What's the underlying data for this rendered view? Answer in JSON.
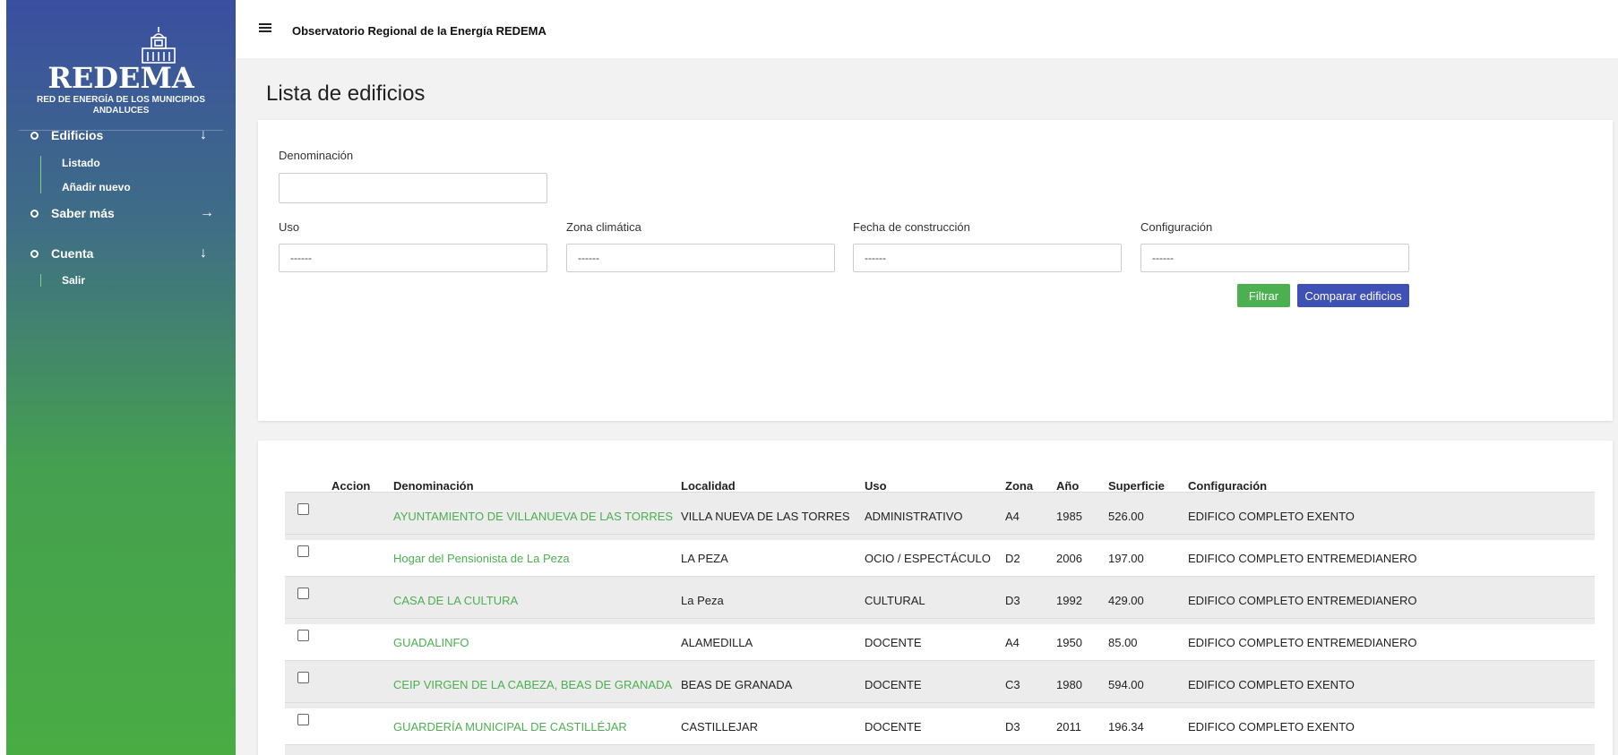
{
  "sidebar": {
    "logo": {
      "title": "REDEMA",
      "subtitle_line1": "RED DE ENERGÍA DE LOS MUNICIPIOS",
      "subtitle_line2": "ANDALUCES"
    },
    "nav": [
      {
        "label": "Edificios",
        "arrow": "↓",
        "children": [
          {
            "label": "Listado"
          },
          {
            "label": "Añadir nuevo"
          }
        ]
      },
      {
        "label": "Saber más",
        "arrow": "→",
        "children": []
      },
      {
        "label": "Cuenta",
        "arrow": "↓",
        "children": [
          {
            "label": "Salir"
          }
        ]
      }
    ]
  },
  "topbar": {
    "title": "Observatorio Regional de la Energía REDEMA"
  },
  "page": {
    "title": "Lista de edificios"
  },
  "filters": {
    "denominacion": {
      "label": "Denominación",
      "value": ""
    },
    "uso": {
      "label": "Uso",
      "value": "------"
    },
    "zona": {
      "label": "Zona climática",
      "value": "------"
    },
    "fecha": {
      "label": "Fecha de construcción",
      "value": "------"
    },
    "config": {
      "label": "Configuración",
      "value": "------"
    },
    "filter_button": "Filtrar",
    "compare_button": "Comparar edificios"
  },
  "table": {
    "columns": [
      "Accion",
      "Denominación",
      "Localidad",
      "Uso",
      "Zona",
      "Año",
      "Superficie",
      "Configuración"
    ],
    "rows": [
      {
        "denominacion": "AYUNTAMIENTO DE VILLANUEVA DE LAS TORRES",
        "localidad": "VILLA NUEVA DE LAS TORRES",
        "uso": "ADMINISTRATIVO",
        "zona": "A4",
        "anio": "1985",
        "superficie": "526.00",
        "config": "EDIFICO COMPLETO EXENTO"
      },
      {
        "denominacion": "Hogar del Pensionista de La Peza",
        "localidad": "LA PEZA",
        "uso": "OCIO / ESPECTÁCULO",
        "zona": "D2",
        "anio": "2006",
        "superficie": "197.00",
        "config": "EDIFICO COMPLETO ENTREMEDIANERO"
      },
      {
        "denominacion": "CASA DE LA CULTURA",
        "localidad": "La Peza",
        "uso": "CULTURAL",
        "zona": "D3",
        "anio": "1992",
        "superficie": "429.00",
        "config": "EDIFICO COMPLETO ENTREMEDIANERO"
      },
      {
        "denominacion": "GUADALINFO",
        "localidad": "ALAMEDILLA",
        "uso": "DOCENTE",
        "zona": "A4",
        "anio": "1950",
        "superficie": "85.00",
        "config": "EDIFICO COMPLETO ENTREMEDIANERO"
      },
      {
        "denominacion": "CEIP VIRGEN DE LA CABEZA, BEAS DE GRANADA",
        "localidad": "BEAS DE GRANADA",
        "uso": "DOCENTE",
        "zona": "C3",
        "anio": "1980",
        "superficie": "594.00",
        "config": "EDIFICO COMPLETO EXENTO"
      },
      {
        "denominacion": "GUARDERÍA MUNICIPAL DE CASTILLÉJAR",
        "localidad": "CASTILLEJAR",
        "uso": "DOCENTE",
        "zona": "D3",
        "anio": "2011",
        "superficie": "196.34",
        "config": "EDIFICO COMPLETO EXENTO"
      },
      {
        "denominacion": "",
        "localidad": "",
        "uso": "",
        "zona": "",
        "anio": "",
        "superficie": "",
        "config": ""
      }
    ]
  }
}
